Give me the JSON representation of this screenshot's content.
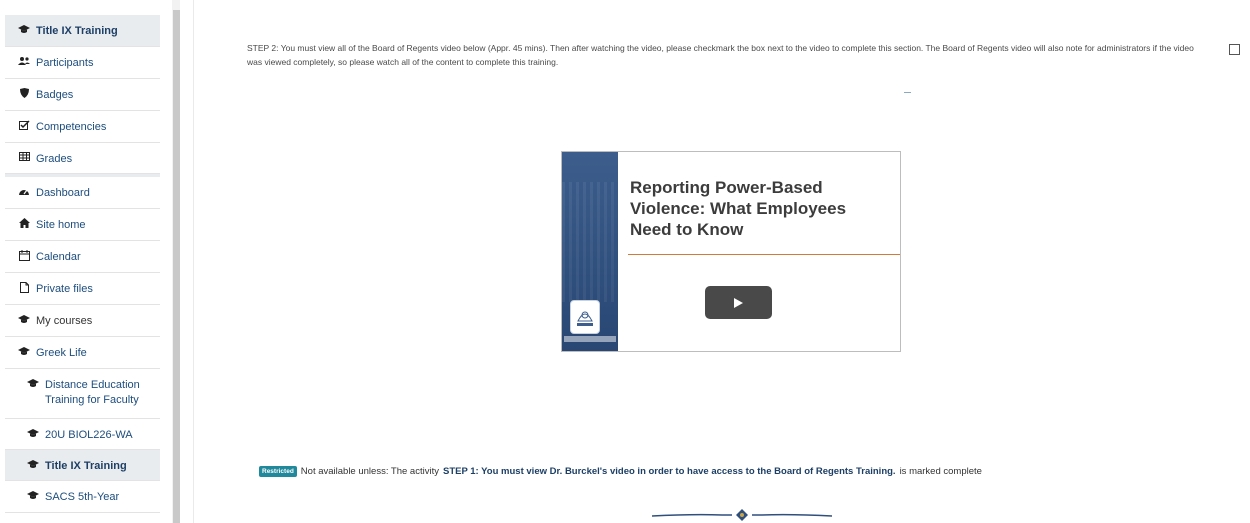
{
  "sidebar": {
    "items": [
      {
        "label": "Title IX Training",
        "icon": "graduation-cap-icon",
        "bold": true
      },
      {
        "label": "Participants",
        "icon": "users-icon"
      },
      {
        "label": "Badges",
        "icon": "shield-icon"
      },
      {
        "label": "Competencies",
        "icon": "checkbox-icon"
      },
      {
        "label": "Grades",
        "icon": "table-icon"
      },
      {
        "label": "Dashboard",
        "icon": "dashboard-icon"
      },
      {
        "label": "Site home",
        "icon": "home-icon"
      },
      {
        "label": "Calendar",
        "icon": "calendar-icon"
      },
      {
        "label": "Private files",
        "icon": "file-icon"
      },
      {
        "label": "My courses",
        "icon": "graduation-cap-icon"
      },
      {
        "label": "Greek Life",
        "icon": "graduation-cap-icon"
      },
      {
        "label": "Distance Education Training for Faculty",
        "icon": "graduation-cap-icon"
      },
      {
        "label": "20U BIOL226-WA",
        "icon": "graduation-cap-icon"
      },
      {
        "label": "Title IX Training",
        "icon": "graduation-cap-icon",
        "bold": true
      },
      {
        "label": "SACS 5th-Year",
        "icon": "graduation-cap-icon"
      }
    ]
  },
  "main": {
    "step_text": "STEP 2: You must view all of the Board of Regents video below (Appr. 45 mins). Then after watching the video, please checkmark the box next to the video to complete this section.  The Board of Regents video will also note for administrators if the video was viewed completely, so please watch all of the content to complete this training.",
    "video": {
      "title": "Reporting Power-Based Violence:  What Employees Need to Know",
      "seal_label": "REGENTS"
    },
    "restricted": {
      "badge": "Restricted",
      "prefix": "Not available unless: The activity ",
      "activity": "STEP 1: You must view Dr. Burckel's video in order to have access to the Board of Regents Training.",
      "suffix": " is marked complete"
    }
  },
  "colors": {
    "nav_text": "#1d4d7d",
    "badge": "#20899b",
    "video_side": "#2f4f7d",
    "video_rule": "#d07a3c"
  }
}
